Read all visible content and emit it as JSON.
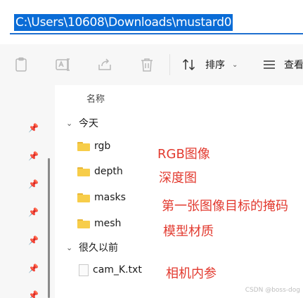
{
  "address_bar": {
    "path": "C:\\Users\\10608\\Downloads\\mustard0"
  },
  "toolbar": {
    "icons": [
      "clipboard-icon",
      "rename-icon",
      "share-icon",
      "delete-icon"
    ],
    "sort_label": "排序",
    "view_label": "查看"
  },
  "file_list": {
    "column_name": "名称",
    "groups": [
      {
        "label": "今天",
        "items": [
          {
            "name": "rgb",
            "type": "folder"
          },
          {
            "name": "depth",
            "type": "folder"
          },
          {
            "name": "masks",
            "type": "folder"
          },
          {
            "name": "mesh",
            "type": "folder"
          }
        ]
      },
      {
        "label": "很久以前",
        "items": [
          {
            "name": "cam_K.txt",
            "type": "file"
          }
        ]
      }
    ]
  },
  "annotations": [
    "RGB图像",
    "深度图",
    "第一张图像目标的掩码",
    "模型材质",
    "相机内参"
  ],
  "watermark": "CSDN @boss-dog",
  "colors": {
    "selection": "#0a6cd6",
    "annotation": "#e23a2f",
    "folder": "#f7cd49"
  }
}
